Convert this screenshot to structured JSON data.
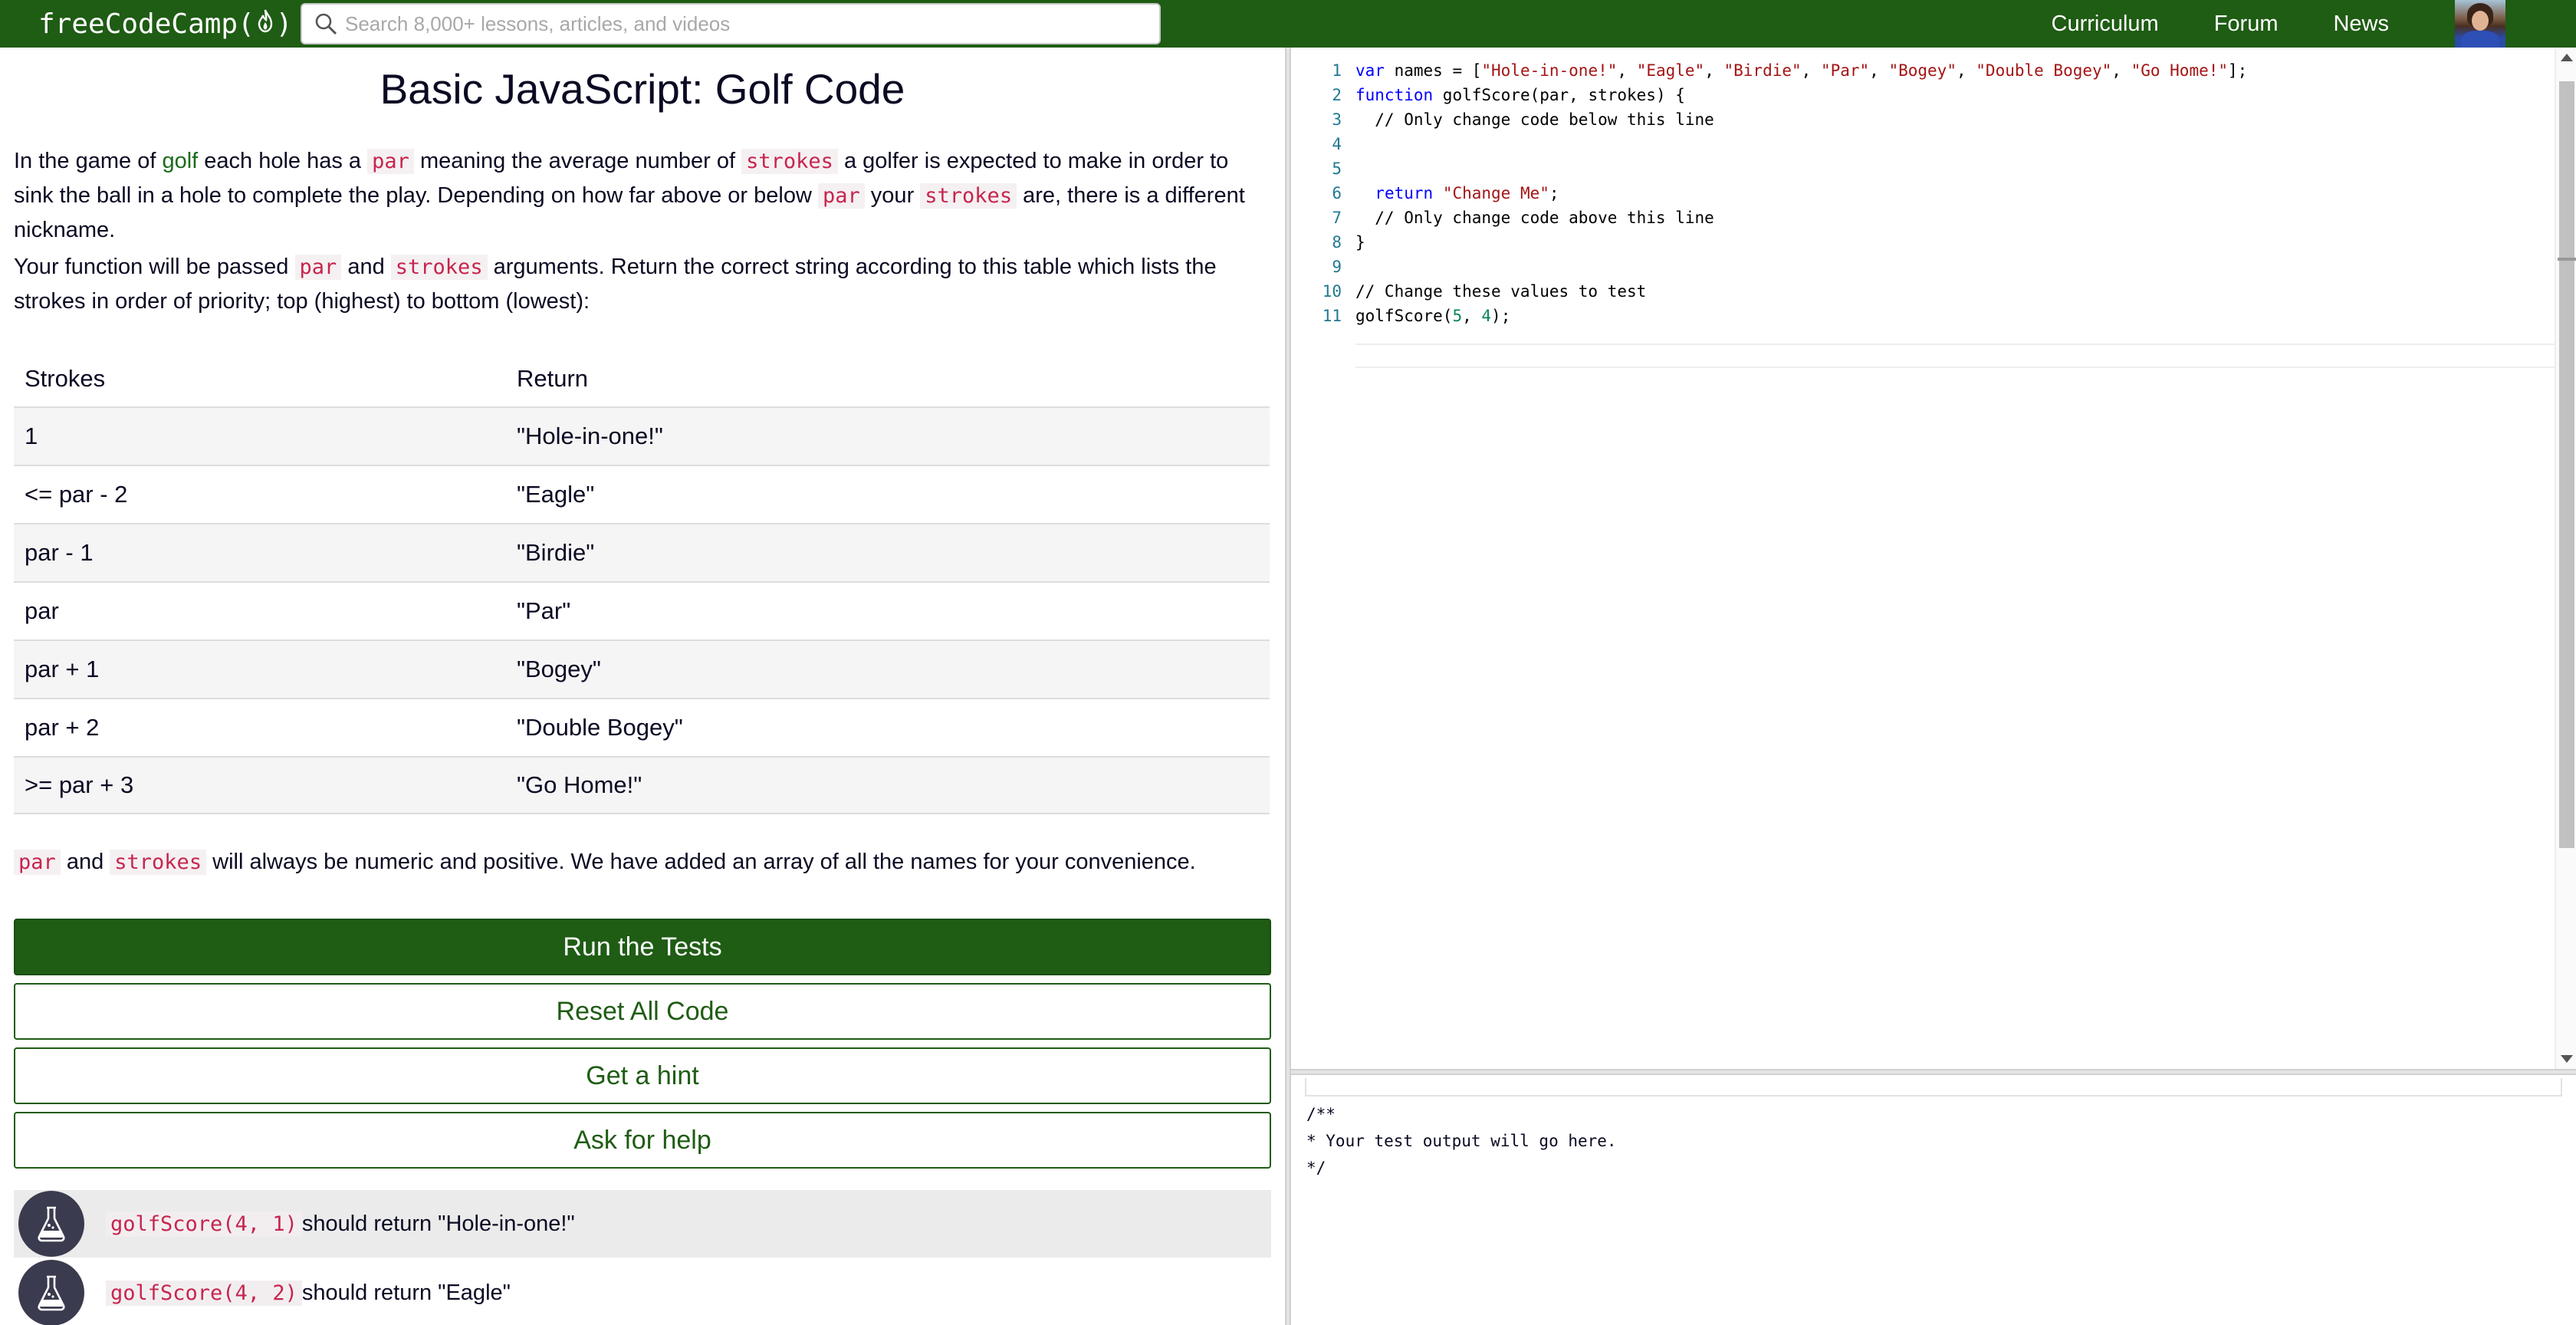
{
  "navbar": {
    "logo_text": "freeCodeCamp",
    "logo_paren_open": "(",
    "logo_paren_close": ")",
    "search_placeholder": "Search 8,000+ lessons, articles, and videos",
    "links": [
      "Curriculum",
      "Forum",
      "News"
    ]
  },
  "challenge": {
    "title": "Basic JavaScript: Golf Code",
    "p1": {
      "a": "In the game of ",
      "golf": "golf",
      "b": " each hole has a ",
      "par": "par",
      "c": " meaning the average number of ",
      "strokes": "strokes",
      "d": " a golfer is expected to make in order to sink the ball in a hole to complete the play. Depending on how far above or below ",
      "par2": "par",
      "e": " your ",
      "strokes2": "strokes",
      "f": " are, there is a different nickname."
    },
    "p2": {
      "a": "Your function will be passed ",
      "par": "par",
      "b": " and ",
      "strokes": "strokes",
      "c": " arguments. Return the correct string according to this table which lists the strokes in order of priority; top (highest) to bottom (lowest):"
    },
    "table": {
      "headers": [
        "Strokes",
        "Return"
      ],
      "rows": [
        [
          "1",
          "\"Hole-in-one!\""
        ],
        [
          "<= par - 2",
          "\"Eagle\""
        ],
        [
          "par - 1",
          "\"Birdie\""
        ],
        [
          "par",
          "\"Par\""
        ],
        [
          "par + 1",
          "\"Bogey\""
        ],
        [
          "par + 2",
          "\"Double Bogey\""
        ],
        [
          ">= par + 3",
          "\"Go Home!\""
        ]
      ]
    },
    "p3": {
      "par": "par",
      "a": " and ",
      "strokes": "strokes",
      "b": " will always be numeric and positive. We have added an array of all the names for your convenience."
    },
    "buttons": {
      "run": "Run the Tests",
      "reset": "Reset All Code",
      "hint": "Get a hint",
      "help": "Ask for help"
    },
    "tests": [
      {
        "code": "golfScore(4, 1)",
        "text": " should return \"Hole-in-one!\""
      },
      {
        "code": "golfScore(4, 2)",
        "text": " should return \"Eagle\""
      }
    ]
  },
  "editor": {
    "line_numbers": [
      "1",
      "2",
      "3",
      "4",
      "5",
      "6",
      "7",
      "8",
      "9",
      "10",
      "11"
    ],
    "lines": {
      "l1_kw": "var",
      "l1_a": " names = [",
      "l1_s1": "\"Hole-in-one!\"",
      "l1_s2": "\"Eagle\"",
      "l1_s3": "\"Birdie\"",
      "l1_s4": "\"Par\"",
      "l1_s5": "\"Bogey\"",
      "l1_s6": "\"Double Bogey\"",
      "l1_s7": "\"Go Home!\"",
      "l1_sep": ", ",
      "l1_end": "];",
      "l2_kw": "function",
      "l2_a": " golfScore(par, strokes) {",
      "l3": "  // Only change code below this line",
      "l6_kw": "return",
      "l6_s": "\"Change Me\"",
      "l6_end": ";",
      "l7": "  // Only change code above this line",
      "l8": "}",
      "l10": "// Change these values to test",
      "l11_a": "golfScore(",
      "l11_n1": "5",
      "l11_sep": ", ",
      "l11_n2": "4",
      "l11_end": ");"
    }
  },
  "output": {
    "text": "/**\n* Your test output will go here.\n*/"
  }
}
